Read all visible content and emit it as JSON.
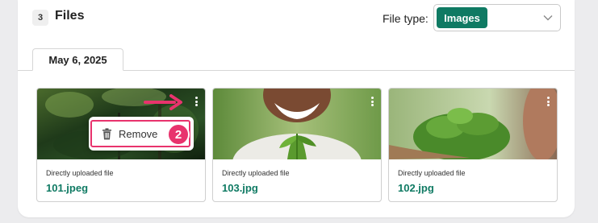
{
  "header": {
    "count": "3",
    "title": "Files",
    "file_type_label": "File type:",
    "file_type_value": "Images"
  },
  "tabs": [
    {
      "label": "May 6, 2025",
      "active": true
    }
  ],
  "files": [
    {
      "caption": "Directly uploaded file",
      "name": "101.jpeg",
      "thumbnail": "forest-image"
    },
    {
      "caption": "Directly uploaded file",
      "name": "103.jpg",
      "thumbnail": "smiling-person-with-seedling-image"
    },
    {
      "caption": "Directly uploaded file",
      "name": "102.jpg",
      "thumbnail": "plant-sprout-image"
    }
  ],
  "context_menu": {
    "items": [
      {
        "label": "Remove",
        "icon": "trash-icon"
      }
    ]
  },
  "annotation": {
    "step_number": "2"
  },
  "colors": {
    "accent": "#0f7a63",
    "highlight": "#e8336d"
  }
}
